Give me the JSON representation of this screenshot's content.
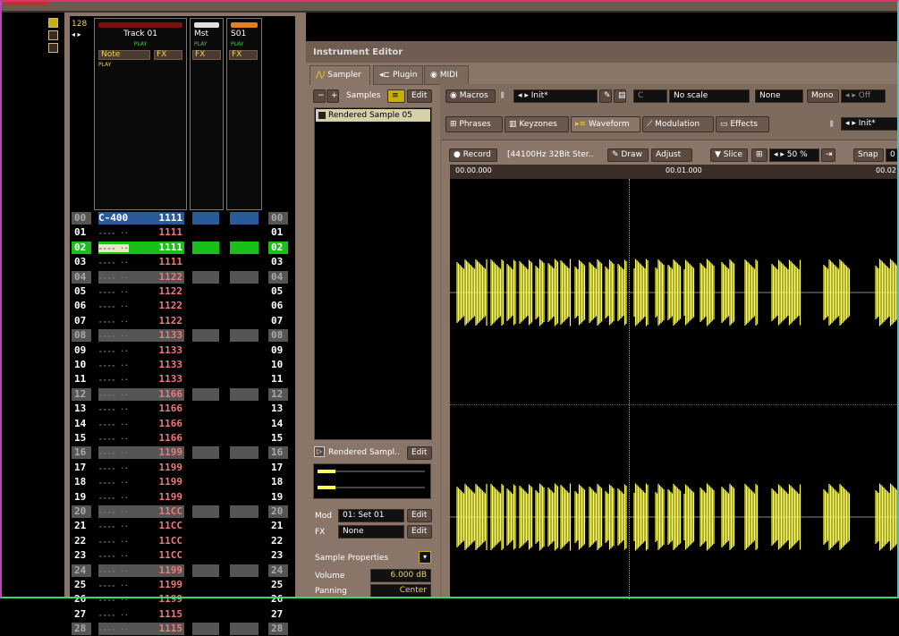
{
  "pattern": {
    "lines_count": "128",
    "tracks": [
      {
        "name": "Track 01",
        "play": "PLAY",
        "note_label": "Note",
        "fx_label": "FX",
        "note_play": "PLAY",
        "color": "#7a1010"
      },
      {
        "name": "Mst",
        "play": "PLAY",
        "fx_label": "FX",
        "color": "#e0e0e0"
      },
      {
        "name": "S01",
        "play": "PLAY",
        "fx_label": "FX",
        "color": "#e08020"
      }
    ],
    "rows": [
      {
        "num": "00",
        "note": "C-400",
        "val": "1111"
      },
      {
        "num": "01",
        "note": "",
        "val": "1111"
      },
      {
        "num": "02",
        "note": "",
        "val": "1111"
      },
      {
        "num": "03",
        "note": "",
        "val": "1111"
      },
      {
        "num": "04",
        "note": "",
        "val": "1122"
      },
      {
        "num": "05",
        "note": "",
        "val": "1122"
      },
      {
        "num": "06",
        "note": "",
        "val": "1122"
      },
      {
        "num": "07",
        "note": "",
        "val": "1122"
      },
      {
        "num": "08",
        "note": "",
        "val": "1133"
      },
      {
        "num": "09",
        "note": "",
        "val": "1133"
      },
      {
        "num": "10",
        "note": "",
        "val": "1133"
      },
      {
        "num": "11",
        "note": "",
        "val": "1133"
      },
      {
        "num": "12",
        "note": "",
        "val": "1166"
      },
      {
        "num": "13",
        "note": "",
        "val": "1166"
      },
      {
        "num": "14",
        "note": "",
        "val": "1166"
      },
      {
        "num": "15",
        "note": "",
        "val": "1166"
      },
      {
        "num": "16",
        "note": "",
        "val": "1199"
      },
      {
        "num": "17",
        "note": "",
        "val": "1199"
      },
      {
        "num": "18",
        "note": "",
        "val": "1199"
      },
      {
        "num": "19",
        "note": "",
        "val": "1199"
      },
      {
        "num": "20",
        "note": "",
        "val": "11CC"
      },
      {
        "num": "21",
        "note": "",
        "val": "11CC"
      },
      {
        "num": "22",
        "note": "",
        "val": "11CC"
      },
      {
        "num": "23",
        "note": "",
        "val": "11CC"
      },
      {
        "num": "24",
        "note": "",
        "val": "1199"
      },
      {
        "num": "25",
        "note": "",
        "val": "1199"
      },
      {
        "num": "26",
        "note": "",
        "val": "1199"
      },
      {
        "num": "27",
        "note": "",
        "val": "1115"
      },
      {
        "num": "28",
        "note": "",
        "val": "1115"
      }
    ],
    "empty_dots": "---- ··",
    "current_row": 2
  },
  "instrument_editor": {
    "title": "Instrument Editor",
    "tabs": [
      "Sampler",
      "Plugin",
      "MIDI"
    ],
    "samples_label": "Samples",
    "edit_label": "Edit",
    "sample_items": [
      "Rendered Sample 05"
    ],
    "macros_label": "Macros",
    "preset": "Init*",
    "key": "C",
    "scale": "No scale",
    "none_label": "None",
    "mono_label": "Mono",
    "off_label": "Off",
    "subtabs": [
      "Phrases",
      "Keyzones",
      "Waveform",
      "Modulation",
      "Effects"
    ],
    "fx_preset": "Init*",
    "record_label": "Record",
    "sample_info": "[44100Hz 32Bit Ster..",
    "draw_label": "Draw",
    "adjust_label": "Adjust",
    "slice_label": "Slice",
    "zoom": "50 %",
    "snap_label": "Snap",
    "snap_value": "0",
    "time_marks": [
      "00.00.000",
      "00.01.000",
      "00.02"
    ],
    "rendered_sample_label": "Rendered Sampl..",
    "mod_label": "Mod",
    "mod_value": "01: Set 01",
    "fx_label": "FX",
    "fx_value": "None",
    "sample_props_label": "Sample Properties",
    "volume_label": "Volume",
    "volume_value": "6.000 dB",
    "panning_label": "Panning",
    "panning_value": "Center"
  },
  "colors": {
    "waveform": "#ffff55",
    "accent_green": "#19c019",
    "panel": "#8a7668"
  }
}
